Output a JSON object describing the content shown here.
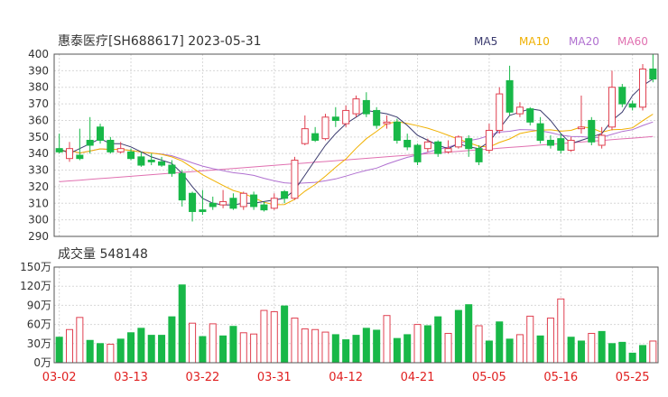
{
  "chart_data": {
    "type": "candlestick",
    "title": "惠泰医疗[SH688617] 2023-05-31",
    "legend": [
      {
        "name": "MA5",
        "color": "#3a3a6e"
      },
      {
        "name": "MA10",
        "color": "#f0b000"
      },
      {
        "name": "MA20",
        "color": "#b070d0"
      },
      {
        "name": "MA60",
        "color": "#e070b0"
      }
    ],
    "price_axis": {
      "ticks": [
        "400",
        "390",
        "380",
        "370",
        "360",
        "350",
        "340",
        "330",
        "320",
        "310",
        "300",
        "290"
      ],
      "ylim": [
        290,
        400
      ]
    },
    "volume_title": "成交量 548148",
    "volume_axis": {
      "ticks": [
        "150万",
        "120万",
        "90万",
        "60万",
        "30万",
        "0万"
      ],
      "ylim": [
        0,
        150
      ]
    },
    "date_labels": [
      "03-02",
      "03-13",
      "03-22",
      "03-31",
      "04-12",
      "04-21",
      "05-05",
      "05-16",
      "05-25"
    ],
    "date_label_positions": [
      0,
      7,
      14,
      21,
      28,
      35,
      42,
      49,
      56
    ],
    "colors": {
      "up": "#e04050",
      "down": "#18b848",
      "grid": "#d8d8d8",
      "axis": "#333333"
    },
    "candles": [
      [
        343,
        352,
        341,
        340,
        352
      ],
      [
        337,
        338,
        343,
        335,
        347
      ],
      [
        339,
        348,
        337,
        336,
        355
      ],
      [
        348,
        358,
        345,
        340,
        362
      ],
      [
        356,
        355,
        348,
        346,
        358
      ],
      [
        348,
        348,
        341,
        340,
        350
      ],
      [
        341,
        341,
        343,
        340,
        347
      ],
      [
        341,
        339,
        337,
        336,
        343
      ],
      [
        338,
        337,
        333,
        332,
        341
      ],
      [
        336,
        335,
        335,
        333,
        340
      ],
      [
        335,
        334,
        333,
        332,
        338
      ],
      [
        333,
        330,
        328,
        326,
        336
      ],
      [
        328,
        325,
        312,
        308,
        330
      ],
      [
        316,
        314,
        305,
        299,
        317
      ],
      [
        306,
        315,
        305,
        303,
        318
      ],
      [
        310,
        311,
        308,
        306,
        314
      ],
      [
        309,
        309,
        311,
        307,
        318
      ],
      [
        313,
        312,
        307,
        306,
        316
      ],
      [
        308,
        310,
        316,
        306,
        317
      ],
      [
        315,
        314,
        308,
        306,
        317
      ],
      [
        309,
        308,
        306,
        305,
        311
      ],
      [
        307,
        308,
        313,
        306,
        316
      ],
      [
        317,
        316,
        313,
        310,
        318
      ],
      [
        313,
        314,
        336,
        312,
        338
      ],
      [
        346,
        347,
        355,
        345,
        363
      ],
      [
        352,
        351,
        348,
        347,
        356
      ],
      [
        349,
        350,
        362,
        348,
        364
      ],
      [
        362,
        365,
        360,
        356,
        368
      ],
      [
        358,
        359,
        366,
        356,
        369
      ],
      [
        364,
        366,
        373,
        362,
        375
      ],
      [
        372,
        370,
        364,
        362,
        377
      ],
      [
        366,
        365,
        357,
        355,
        368
      ],
      [
        358,
        357,
        359,
        355,
        363
      ],
      [
        359,
        358,
        348,
        346,
        361
      ],
      [
        348,
        348,
        344,
        342,
        352
      ],
      [
        345,
        344,
        335,
        333,
        346
      ],
      [
        343,
        342,
        347,
        341,
        349
      ],
      [
        347,
        346,
        340,
        338,
        348
      ],
      [
        341,
        341,
        343,
        340,
        348
      ],
      [
        344,
        344,
        350,
        343,
        351
      ],
      [
        349,
        348,
        343,
        338,
        351
      ],
      [
        343,
        342,
        335,
        333,
        345
      ],
      [
        342,
        341,
        354,
        340,
        358
      ],
      [
        354,
        353,
        376,
        352,
        380
      ],
      [
        384,
        383,
        365,
        363,
        393
      ],
      [
        364,
        364,
        368,
        362,
        371
      ],
      [
        367,
        367,
        359,
        357,
        368
      ],
      [
        358,
        357,
        348,
        346,
        362
      ],
      [
        348,
        348,
        345,
        343,
        351
      ],
      [
        349,
        349,
        342,
        340,
        352
      ],
      [
        342,
        342,
        348,
        341,
        350
      ],
      [
        355,
        354,
        356,
        352,
        375
      ],
      [
        360,
        360,
        347,
        345,
        362
      ],
      [
        345,
        346,
        351,
        343,
        356
      ],
      [
        356,
        355,
        380,
        354,
        390
      ],
      [
        380,
        380,
        370,
        368,
        382
      ],
      [
        370,
        370,
        368,
        366,
        372
      ],
      [
        368,
        369,
        391,
        366,
        394
      ],
      [
        391,
        390,
        385,
        383,
        400
      ]
    ],
    "volumes": [
      [
        40,
        false
      ],
      [
        52,
        true
      ],
      [
        71,
        true
      ],
      [
        35,
        false
      ],
      [
        30,
        false
      ],
      [
        29,
        true
      ],
      [
        37,
        false
      ],
      [
        47,
        false
      ],
      [
        54,
        false
      ],
      [
        43,
        false
      ],
      [
        43,
        false
      ],
      [
        72,
        false
      ],
      [
        122,
        false
      ],
      [
        62,
        true
      ],
      [
        41,
        false
      ],
      [
        61,
        true
      ],
      [
        42,
        false
      ],
      [
        57,
        false
      ],
      [
        47,
        true
      ],
      [
        45,
        true
      ],
      [
        82,
        true
      ],
      [
        80,
        true
      ],
      [
        89,
        false
      ],
      [
        70,
        true
      ],
      [
        53,
        true
      ],
      [
        52,
        true
      ],
      [
        48,
        true
      ],
      [
        44,
        false
      ],
      [
        36,
        false
      ],
      [
        43,
        false
      ],
      [
        54,
        false
      ],
      [
        51,
        false
      ],
      [
        74,
        true
      ],
      [
        38,
        false
      ],
      [
        44,
        false
      ],
      [
        60,
        true
      ],
      [
        58,
        false
      ],
      [
        72,
        false
      ],
      [
        46,
        true
      ],
      [
        82,
        false
      ],
      [
        91,
        false
      ],
      [
        58,
        true
      ],
      [
        34,
        false
      ],
      [
        64,
        false
      ],
      [
        37,
        false
      ],
      [
        44,
        true
      ],
      [
        73,
        true
      ],
      [
        42,
        false
      ],
      [
        70,
        true
      ],
      [
        100,
        true
      ],
      [
        40,
        false
      ],
      [
        34,
        false
      ],
      [
        46,
        true
      ],
      [
        49,
        false
      ],
      [
        30,
        false
      ],
      [
        32,
        false
      ],
      [
        15,
        false
      ],
      [
        27,
        false
      ],
      [
        34,
        true
      ]
    ],
    "ma5": [
      343,
      340,
      343,
      346,
      349,
      346,
      346,
      344,
      341,
      338,
      336,
      334,
      328,
      320,
      313,
      310,
      309,
      309,
      310,
      310,
      311,
      312,
      313,
      318,
      327,
      336,
      345,
      352,
      358,
      362,
      366,
      365,
      364,
      362,
      357,
      351,
      348,
      345,
      343,
      346,
      344,
      343,
      347,
      355,
      363,
      365,
      367,
      366,
      360,
      352,
      346,
      348,
      350,
      352,
      360,
      365,
      375,
      381,
      385
    ]
  }
}
